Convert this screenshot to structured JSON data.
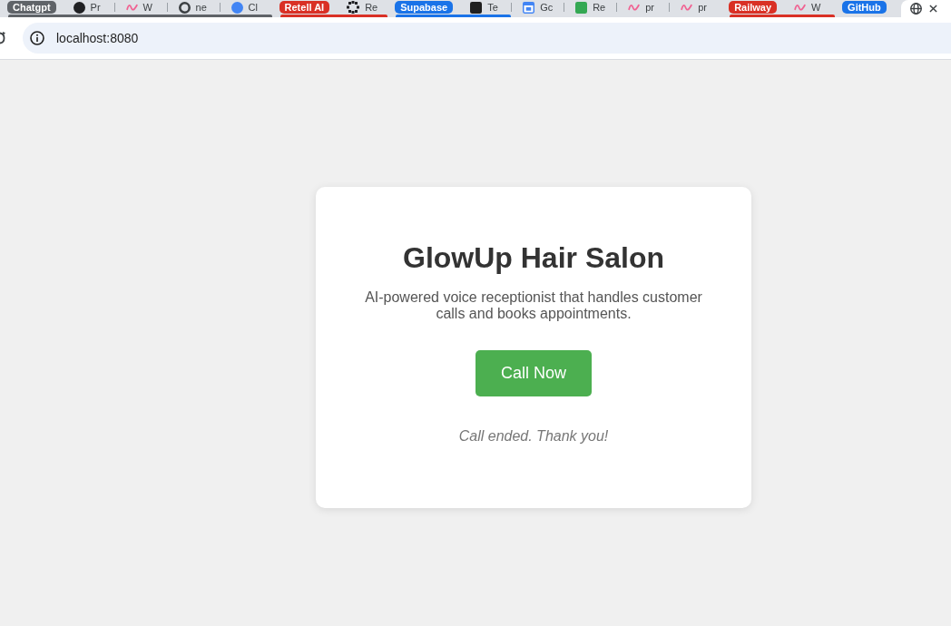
{
  "tab_strip": [
    {
      "kind": "group",
      "label": "Chatgpt",
      "color": "#5f6368",
      "tabs": [
        {
          "title": "Pr",
          "selected": false,
          "favicon": {
            "kind": "circle",
            "color": "#202124"
          }
        },
        {
          "title": "W",
          "selected": false,
          "favicon": {
            "kind": "squiggle",
            "color": "#f06292"
          }
        },
        {
          "title": "ne",
          "selected": false,
          "favicon": {
            "kind": "ring",
            "color": "#3c4043"
          }
        },
        {
          "title": "Cl",
          "selected": false,
          "favicon": {
            "kind": "circle",
            "color": "#4285f4"
          }
        }
      ]
    },
    {
      "kind": "group",
      "label": "Retell AI",
      "color": "#d93025",
      "tabs": [
        {
          "title": "Re",
          "selected": false,
          "favicon": {
            "kind": "dots",
            "color": "#202124"
          }
        }
      ]
    },
    {
      "kind": "group",
      "label": "Supabase",
      "color": "#1a73e8",
      "tabs": [
        {
          "title": "Te",
          "selected": false,
          "favicon": {
            "kind": "square",
            "color": "#1f1f1f"
          }
        }
      ]
    },
    {
      "kind": "tab",
      "title": "Gc",
      "selected": false,
      "favicon": {
        "kind": "calendar",
        "color": "#4285f4"
      }
    },
    {
      "kind": "tab",
      "title": "Re",
      "selected": false,
      "favicon": {
        "kind": "square",
        "color": "#34a853"
      }
    },
    {
      "kind": "tab",
      "title": "pr",
      "selected": false,
      "favicon": {
        "kind": "squiggle",
        "color": "#f06292"
      }
    },
    {
      "kind": "tab",
      "title": "pr",
      "selected": false,
      "favicon": {
        "kind": "squiggle",
        "color": "#f06292"
      }
    },
    {
      "kind": "group",
      "label": "Railway",
      "color": "#d93025",
      "tabs": [
        {
          "title": "W",
          "selected": false,
          "favicon": {
            "kind": "squiggle",
            "color": "#f06292"
          }
        }
      ]
    },
    {
      "kind": "group",
      "label": "GitHub",
      "color": "#1a73e8"
    },
    {
      "kind": "tab",
      "selected": true,
      "favicon": {
        "kind": "globe",
        "color": "#3c4043"
      }
    }
  ],
  "address_bar": {
    "url": "localhost:8080"
  },
  "card": {
    "title": "GlowUp Hair Salon",
    "description": "AI-powered voice receptionist that handles customer calls and books appointments.",
    "call_button": "Call Now",
    "status": "Call ended. Thank you!"
  }
}
